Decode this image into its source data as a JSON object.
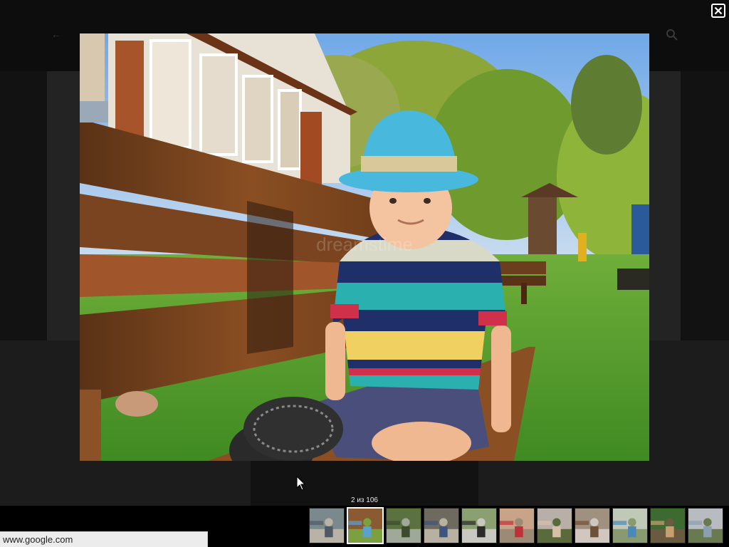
{
  "lightbox": {
    "counter": "2 из 106",
    "close_label": "close",
    "main_image": {
      "icon": "photo",
      "watermark": "dreamstime"
    },
    "thumbnails": [
      {
        "icon": "photo",
        "active": false,
        "palette": [
          "#7a8a8c",
          "#4f5a66",
          "#b9b2a6"
        ]
      },
      {
        "icon": "photo",
        "active": true,
        "palette": [
          "#8a5a32",
          "#5aa0d0",
          "#7aa040"
        ]
      },
      {
        "icon": "photo",
        "active": false,
        "palette": [
          "#5b7240",
          "#3d4a2e",
          "#a0a89a"
        ]
      },
      {
        "icon": "photo",
        "active": false,
        "palette": [
          "#6e6a60",
          "#3c5680",
          "#b8b0a0"
        ]
      },
      {
        "icon": "photo",
        "active": false,
        "palette": [
          "#8aa070",
          "#2a2a2a",
          "#c8c8c0"
        ]
      },
      {
        "icon": "photo",
        "active": false,
        "palette": [
          "#c7a488",
          "#c0303a",
          "#9c8a74"
        ]
      },
      {
        "icon": "photo",
        "active": false,
        "palette": [
          "#b8b0a8",
          "#d8c0a8",
          "#5a6a3a"
        ]
      },
      {
        "icon": "photo",
        "active": false,
        "palette": [
          "#a09080",
          "#6e5038",
          "#d0c8c0"
        ]
      },
      {
        "icon": "photo",
        "active": false,
        "palette": [
          "#c0c8b8",
          "#4a88b8",
          "#8a9a70"
        ]
      },
      {
        "icon": "photo",
        "active": false,
        "palette": [
          "#3c6a30",
          "#c8a070",
          "#6a5a40"
        ]
      },
      {
        "icon": "photo",
        "active": false,
        "palette": [
          "#b8bcc0",
          "#8aa0b0",
          "#6a7a50"
        ]
      }
    ]
  },
  "status_bar": {
    "url": "www.google.com"
  },
  "colors": {
    "overlay": "#141414",
    "thumb_active_border": "#ffffff",
    "close_button": "#ffffff"
  }
}
